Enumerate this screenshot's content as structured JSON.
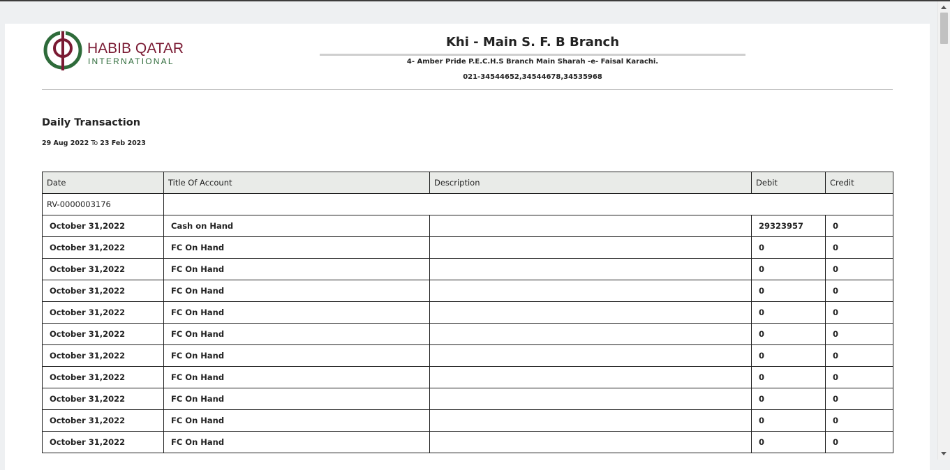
{
  "logo": {
    "word1": "HABIB QATAR",
    "word2": "INTERNATIONAL",
    "colors": {
      "maroon": "#7a1a33",
      "green": "#2e6b3a"
    }
  },
  "branch": {
    "title": "Khi - Main S. F. B Branch",
    "address": "4- Amber Pride P.E.C.H.S Branch Main Sharah -e- Faisal Karachi.",
    "phone": "021-34544652,34544678,34535968"
  },
  "report": {
    "title": "Daily Transaction",
    "date_from": "29 Aug 2022",
    "date_to_word": "To",
    "date_to": "23 Feb 2023"
  },
  "table": {
    "columns": [
      "Date",
      "Title Of Account",
      "Description",
      "Debit",
      "Credit"
    ],
    "voucher": "RV-0000003176",
    "rows": [
      {
        "date": "October 31,2022",
        "account": "Cash on Hand",
        "description": "",
        "debit": "29323957",
        "credit": "0"
      },
      {
        "date": "October 31,2022",
        "account": "FC On Hand",
        "description": "",
        "debit": "0",
        "credit": "0"
      },
      {
        "date": "October 31,2022",
        "account": "FC On Hand",
        "description": "",
        "debit": "0",
        "credit": "0"
      },
      {
        "date": "October 31,2022",
        "account": "FC On Hand",
        "description": "",
        "debit": "0",
        "credit": "0"
      },
      {
        "date": "October 31,2022",
        "account": "FC On Hand",
        "description": "",
        "debit": "0",
        "credit": "0"
      },
      {
        "date": "October 31,2022",
        "account": "FC On Hand",
        "description": "",
        "debit": "0",
        "credit": "0"
      },
      {
        "date": "October 31,2022",
        "account": "FC On Hand",
        "description": "",
        "debit": "0",
        "credit": "0"
      },
      {
        "date": "October 31,2022",
        "account": "FC On Hand",
        "description": "",
        "debit": "0",
        "credit": "0"
      },
      {
        "date": "October 31,2022",
        "account": "FC On Hand",
        "description": "",
        "debit": "0",
        "credit": "0"
      },
      {
        "date": "October 31,2022",
        "account": "FC On Hand",
        "description": "",
        "debit": "0",
        "credit": "0"
      },
      {
        "date": "October 31,2022",
        "account": "FC On Hand",
        "description": "",
        "debit": "0",
        "credit": "0"
      }
    ]
  },
  "icons": {
    "logo_emblem": "hqi-logo-icon",
    "scroll_up": "arrow-up-icon",
    "scroll_down": "arrow-down-icon"
  }
}
